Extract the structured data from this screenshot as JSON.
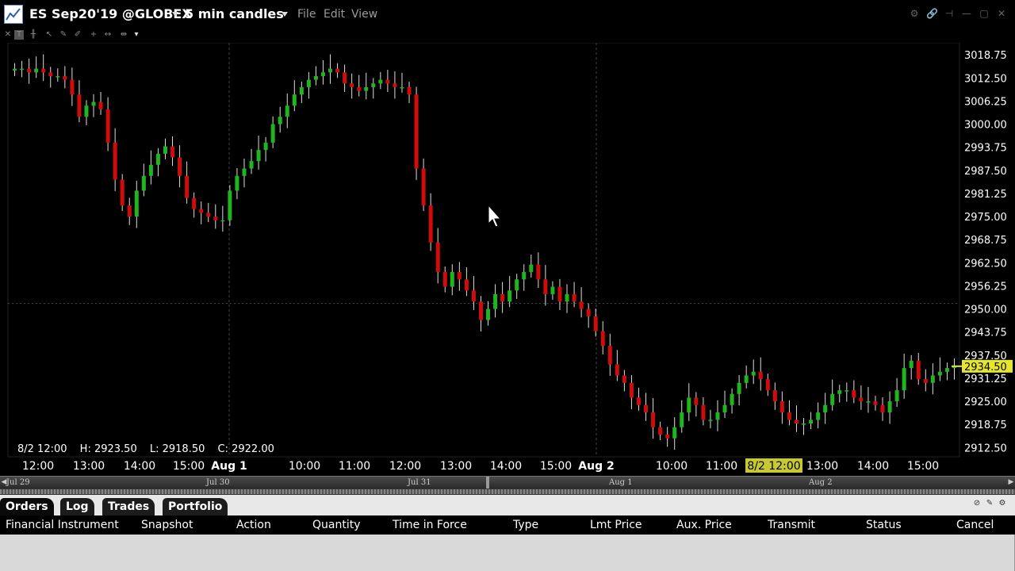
{
  "window": {
    "title": "ES Sep20'19 @GLOBEX",
    "subtitle": "5 min candles",
    "menu": [
      "File",
      "Edit",
      "View"
    ]
  },
  "ohlc": {
    "time": "8/2 12:00",
    "high": "H: 2923.50",
    "low": "L: 2918.50",
    "close": "C: 2922.00"
  },
  "price_axis": {
    "labels": [
      "3018.75",
      "3012.50",
      "3006.25",
      "3000.00",
      "2993.75",
      "2987.50",
      "2981.25",
      "2975.00",
      "2968.75",
      "2962.50",
      "2956.25",
      "2950.00",
      "2943.75",
      "2937.50",
      "2931.25",
      "2925.00",
      "2918.75",
      "2912.50"
    ],
    "current_price": "2934.50",
    "current_price_color": "#e6e62a"
  },
  "time_axis": {
    "labels": [
      "12:00",
      "13:00",
      "14:00",
      "15:00",
      "Aug 1",
      "10:00",
      "11:00",
      "12:00",
      "13:00",
      "14:00",
      "15:00",
      "Aug 2",
      "10:00",
      "11:00",
      "8/2 12:00",
      "13:00",
      "14:00",
      "15:00"
    ],
    "bold": [
      "Aug 1",
      "Aug 2"
    ],
    "highlight": "8/2 12:00",
    "highlight_color": "#c8c832"
  },
  "navigator": {
    "labels": [
      "Jul 29",
      "Jul 30",
      "Jul 31",
      "Aug 1",
      "Aug 2"
    ]
  },
  "colors": {
    "up": "#1fb51f",
    "down": "#d00b0b",
    "grid": "#333333"
  },
  "chart_data": {
    "type": "candlestick",
    "title": "",
    "ylim": [
      2910,
      3022
    ],
    "series": [
      {
        "values": [
          3015,
          3015,
          3014,
          3015,
          3014,
          3013,
          3013,
          3012,
          3008,
          3002,
          3005,
          3006,
          3004,
          2995,
          2985,
          2978,
          2975,
          2982,
          2986,
          2989,
          2992,
          2994,
          2991,
          2986,
          2980,
          2977,
          2976,
          2975,
          2974,
          2974,
          2982,
          2986,
          2988,
          2990,
          2993,
          2995,
          3000,
          3002,
          3005,
          3008,
          3010,
          3012,
          3013,
          3014,
          3015,
          3014,
          3011,
          3010,
          3009,
          3010,
          3011,
          3012,
          3011,
          3010,
          3010,
          3008,
          2988,
          2978,
          2968,
          2960,
          2956,
          2960,
          2958,
          2955,
          2952,
          2947,
          2950,
          2954,
          2952,
          2955,
          2958,
          2960,
          2962,
          2958,
          2954,
          2956,
          2952,
          2954,
          2952,
          2950,
          2948,
          2944,
          2940,
          2935,
          2932,
          2930,
          2926,
          2924,
          2922,
          2918,
          2916,
          2915,
          2918,
          2922,
          2926,
          2924,
          2920,
          2920,
          2922,
          2924,
          2927,
          2930,
          2932,
          2933,
          2931,
          2928,
          2925,
          2922,
          2920,
          2919,
          2919,
          2920,
          2922,
          2924,
          2927,
          2928,
          2928,
          2926,
          2925,
          2925,
          2924,
          2922,
          2925,
          2928,
          2934,
          2936,
          2931,
          2930,
          2932,
          2933,
          2934,
          2934.5
        ]
      }
    ]
  },
  "bottom_panel": {
    "tabs": [
      "Orders",
      "Log",
      "Trades",
      "Portfolio"
    ],
    "columns": [
      "Financial Instrument",
      "Snapshot",
      "Action",
      "Quantity",
      "Time in Force",
      "Type",
      "Lmt Price",
      "Aux. Price",
      "Transmit",
      "Status",
      "Cancel"
    ]
  }
}
